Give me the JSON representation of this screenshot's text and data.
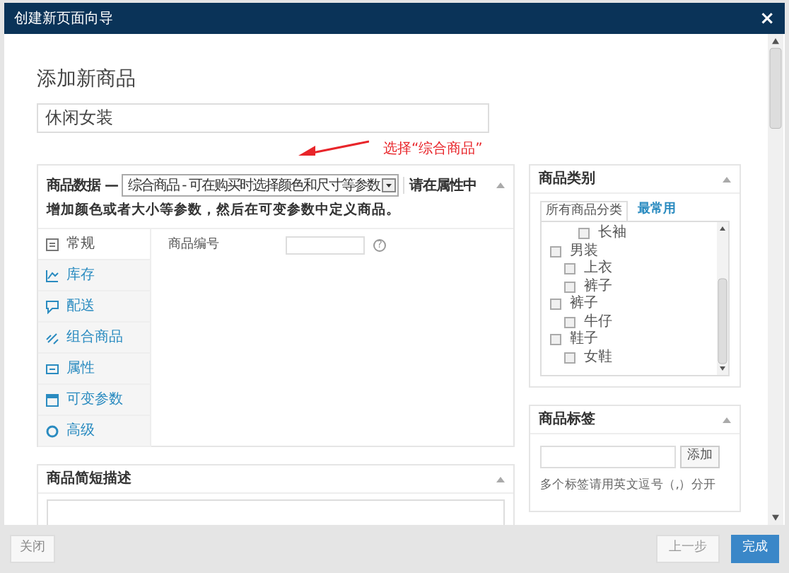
{
  "window": {
    "title": "创建新页面向导",
    "close": "×"
  },
  "heading": "添加新商品",
  "title_field": {
    "value": "休闲女装"
  },
  "annotation": "选择“综合商品”",
  "product_data": {
    "title": "商品数据 —",
    "type_select": "综合商品 - 可在购买时选择颜色和尺寸等参数",
    "note_1": "请在属性中",
    "note_2": "增加颜色或者大小等参数，然后在可变参数中定义商品。",
    "tabs": [
      {
        "label": "常规",
        "kind": "general",
        "selected": true
      },
      {
        "label": "库存",
        "kind": "inventory",
        "selected": false
      },
      {
        "label": "配送",
        "kind": "shipping",
        "selected": false
      },
      {
        "label": "组合商品",
        "kind": "linked",
        "selected": false
      },
      {
        "label": "属性",
        "kind": "attributes",
        "selected": false
      },
      {
        "label": "可变参数",
        "kind": "variations",
        "selected": false
      },
      {
        "label": "高级",
        "kind": "advanced",
        "selected": false
      }
    ],
    "sku_label": "商品编号",
    "sku_help": "?"
  },
  "short_description": {
    "title": "商品简短描述"
  },
  "categories": {
    "title": "商品类别",
    "tabs": [
      {
        "label": "所有商品分类",
        "selected": true
      },
      {
        "label": "最常用",
        "selected": false
      }
    ],
    "tree": [
      {
        "children": [
          {
            "children": [
              {
                "label": "长袖",
                "checked": false
              }
            ]
          }
        ]
      },
      {
        "label": "男装",
        "checked": false,
        "children": [
          {
            "label": "上衣",
            "checked": false
          },
          {
            "label": "裤子",
            "checked": false
          }
        ]
      },
      {
        "label": "裤子",
        "checked": false,
        "children": [
          {
            "label": "牛仔",
            "checked": false
          }
        ]
      },
      {
        "label": "鞋子",
        "checked": false,
        "children": [
          {
            "label": "女鞋",
            "checked": false
          }
        ]
      }
    ]
  },
  "tags": {
    "title": "商品标签",
    "add_button": "添加",
    "hint": "多个标签请用英文逗号（,）分开"
  },
  "footer": {
    "close": "关闭",
    "back": "上一步",
    "finish": "完成"
  }
}
